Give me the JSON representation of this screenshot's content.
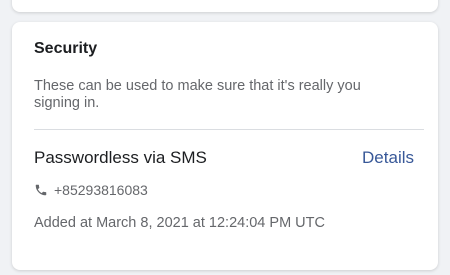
{
  "security": {
    "title": "Security",
    "description": "These can be used to make sure that it's really you signing in.",
    "method": {
      "title": "Passwordless via SMS",
      "details_label": "Details",
      "phone_icon": "phone-icon",
      "phone": "+85293816083",
      "added": "Added at March 8, 2021 at 12:24:04 PM UTC"
    }
  },
  "colors": {
    "link": "#385898",
    "muted_text": "#65676b",
    "primary_text": "#1c1e21",
    "background": "#f0f2f5"
  }
}
